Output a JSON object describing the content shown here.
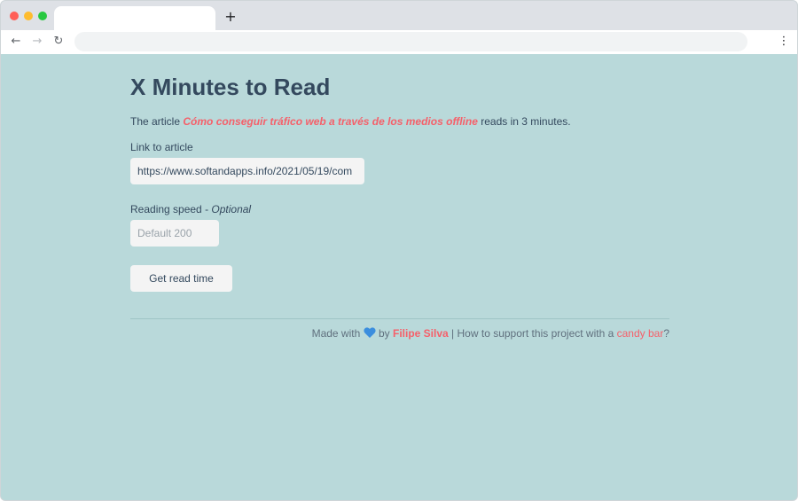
{
  "browser": {
    "new_tab_symbol": "+",
    "back_icon": "←",
    "forward_icon": "→",
    "reload_icon": "↻",
    "menu_icon": "⋮"
  },
  "page": {
    "title": "X Minutes to Read",
    "result": {
      "prefix": "The article ",
      "article_title": "Cómo conseguir tráfico web a través de los medios offline",
      "suffix": " reads in 3 minutes."
    },
    "link_label": "Link to article",
    "link_value": "https://www.softandapps.info/2021/05/19/com",
    "speed_label": "Reading speed - ",
    "speed_optional": "Optional",
    "speed_placeholder": "Default 200",
    "button_label": "Get read time"
  },
  "footer": {
    "made_with": "Made with",
    "heart_icon": "blue-heart-icon",
    "by": "by",
    "author": "Filipe Silva",
    "separator": "|",
    "support_text": "How to support this project with a",
    "candy_link": "candy bar",
    "question_mark": "?"
  },
  "colors": {
    "background": "#b9d9da",
    "text": "#34495e",
    "accent": "#f5606a",
    "heart": "#3b8ede"
  }
}
